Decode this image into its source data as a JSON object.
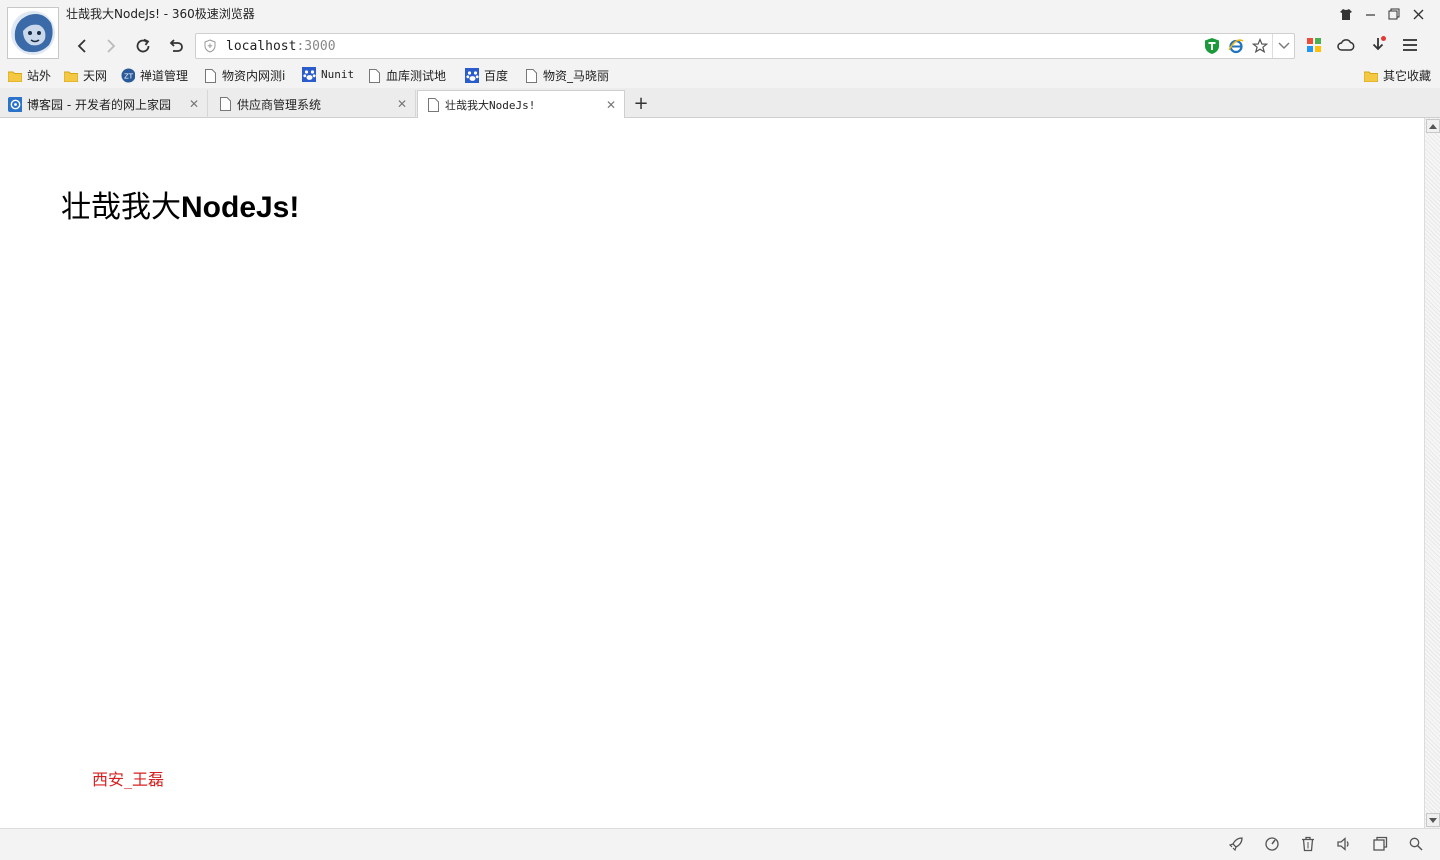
{
  "window": {
    "title": "壮哉我大NodeJs! - 360极速浏览器"
  },
  "addressbar": {
    "host": "localhost",
    "port": ":3000"
  },
  "bookmarks": [
    {
      "label": "站外",
      "icon": "folder-icon"
    },
    {
      "label": "天网",
      "icon": "folder-icon"
    },
    {
      "label": "禅道管理",
      "icon": "zt-logo-icon"
    },
    {
      "label": "物资内网测i",
      "icon": "page-icon"
    },
    {
      "label": "Nunit",
      "icon": "paw-icon"
    },
    {
      "label": "血库测试地",
      "icon": "page-icon"
    },
    {
      "label": "百度",
      "icon": "paw-icon"
    },
    {
      "label": "物资_马晓丽",
      "icon": "page-icon"
    }
  ],
  "other_bookmarks": {
    "label": "其它收藏",
    "icon": "folder-icon"
  },
  "tabs": [
    {
      "label": "博客园 - 开发者的网上家园",
      "icon": "cnblogs-icon",
      "active": false
    },
    {
      "label": "供应商管理系统",
      "icon": "page-icon",
      "active": false
    },
    {
      "label": "壮哉我大NodeJs!",
      "icon": "page-icon",
      "active": true
    }
  ],
  "content": {
    "heading_cjk": "壮哉我大",
    "heading_latin": "NodeJs!",
    "footer_name": "西安_王磊"
  },
  "colors": {
    "footer_text": "#d42020",
    "shield_green": "#1a9a3a",
    "ie_blue": "#1e73be"
  }
}
